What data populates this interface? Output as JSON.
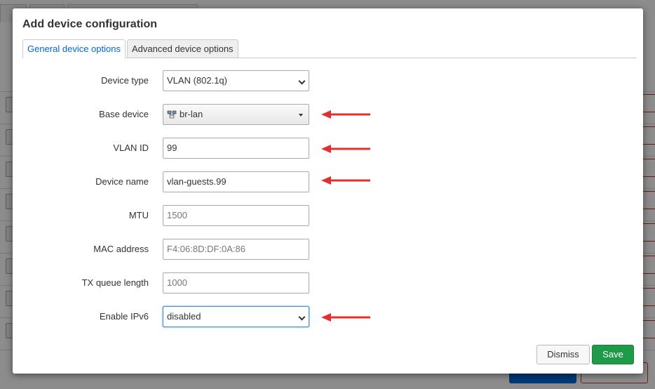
{
  "modal": {
    "title": "Add device configuration",
    "tabs": [
      {
        "label": "General device options",
        "active": true
      },
      {
        "label": "Advanced device options",
        "active": false
      }
    ],
    "fields": {
      "device_type": {
        "label": "Device type",
        "value": "VLAN (802.1q)"
      },
      "base_device": {
        "label": "Base device",
        "value": "br-lan",
        "icon": "network-bridge-icon"
      },
      "vlan_id": {
        "label": "VLAN ID",
        "value": "99"
      },
      "device_name": {
        "label": "Device name",
        "value": "vlan-guests.99"
      },
      "mtu": {
        "label": "MTU",
        "placeholder": "1500"
      },
      "mac_address": {
        "label": "MAC address",
        "placeholder": "F4:06:8D:DF:0A:86"
      },
      "tx_queue_length": {
        "label": "TX queue length",
        "placeholder": "1000"
      },
      "enable_ipv6": {
        "label": "Enable IPv6",
        "value": "disabled"
      }
    },
    "buttons": {
      "dismiss": "Dismiss",
      "save": "Save"
    }
  },
  "colors": {
    "accent": "#0069d9",
    "save": "#1e9a48",
    "annotation_arrow": "#e03030"
  }
}
